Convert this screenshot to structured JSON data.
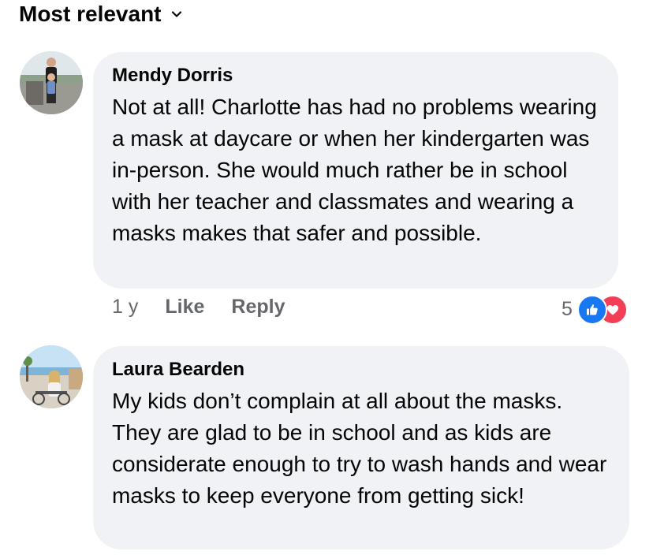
{
  "sort": {
    "label": "Most relevant",
    "icon": "chevron-down-icon"
  },
  "comments": [
    {
      "author": "Mendy Dorris",
      "text": "Not at all! Charlotte has had no problems wearing a mask at daycare or when her kindergarten was in-person. She would much rather be in school with her teacher and classmates and wearing a masks makes that safer and possible.",
      "time": "1 y",
      "like_label": "Like",
      "reply_label": "Reply",
      "reaction_count": "5",
      "reactions": [
        "like-icon",
        "love-icon"
      ]
    },
    {
      "author": "Laura Bearden",
      "text": "My kids don’t complain at all about the masks. They are glad to be in school and as kids are considerate enough to try to wash hands and wear masks to keep everyone from getting sick!"
    }
  ],
  "colors": {
    "bubble": "#f0f2f5",
    "meta_text": "#65676b",
    "like_blue": "#1877f2",
    "love_red": "#f33e58"
  }
}
